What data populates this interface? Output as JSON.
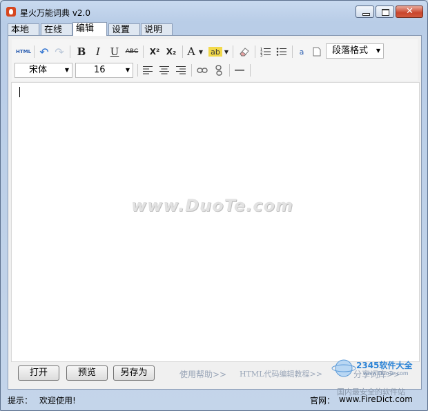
{
  "window": {
    "title": "星火万能词典 v2.0"
  },
  "tabs": [
    "本地",
    "在线",
    "编辑",
    "设置",
    "说明"
  ],
  "toolbar": {
    "html_label": "HTML",
    "bold": "B",
    "italic": "I",
    "underline": "U",
    "strike": "ABC",
    "superscript": "X²",
    "subscript": "X₂",
    "font_color": "A",
    "highlight": "ab",
    "paragraph_format": "段落格式",
    "font_family": "宋体",
    "font_size": "16"
  },
  "editor": {
    "watermark": "www.DuoTe.com"
  },
  "buttons": {
    "open": "打开",
    "preview": "预览",
    "save_as": "另存为"
  },
  "links": {
    "help": "使用帮助>>",
    "html_tutorial": "HTML代码编辑教程>>",
    "share": "分享词库>>"
  },
  "status": {
    "hint_label": "提示：",
    "hint": "欢迎使用!",
    "site_label": "官网：",
    "site": "www.FireDict.com"
  },
  "corner_logo": {
    "brand": "2345软件大全",
    "url": "www.DuoTe.com",
    "slogan": "国内最安全的软件站"
  }
}
